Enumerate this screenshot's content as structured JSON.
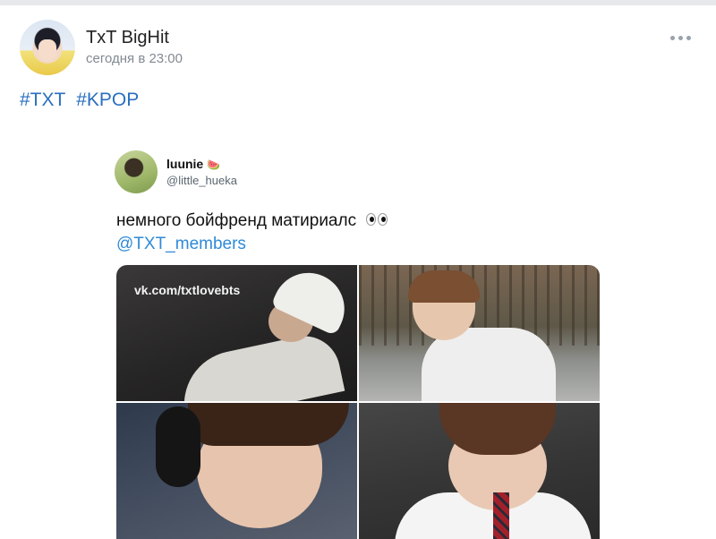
{
  "post": {
    "author": "TxT BigHit",
    "time": "сегодня в 23:00",
    "tags": [
      "#TXT",
      "#KPOP"
    ]
  },
  "tweet": {
    "name": "luunie",
    "emoji": "🍉",
    "handle": "@little_hueka",
    "text": "немного бойфренд матириалс",
    "mention": "@TXT_members",
    "watermark": "vk.com/txtlovebts"
  },
  "colors": {
    "link": "#2a6fbf",
    "mention": "#2f8ad8",
    "muted": "#828a93"
  },
  "icons": {
    "more": "more-dots-icon"
  }
}
